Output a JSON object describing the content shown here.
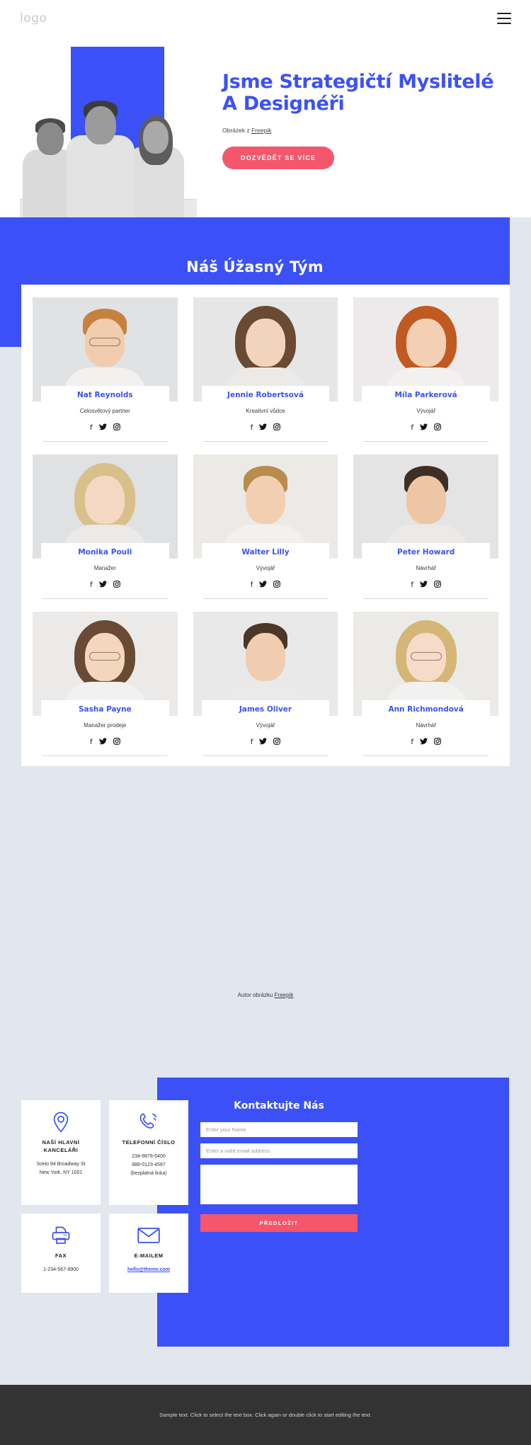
{
  "header": {
    "logo": "logo",
    "menu_icon": "hamburger-menu-icon"
  },
  "hero": {
    "title": "Jsme Strategičtí Myslitelé A Designéři",
    "credit_prefix": "Obrázek z ",
    "credit_link": "Freepik",
    "cta_label": "DOZVĚDĚT SE VÍCE",
    "accent_blue": "#3b51f7",
    "accent_pink": "#f4566c"
  },
  "team": {
    "heading": "Náš Úžasný Tým",
    "credit_prefix": "Autor obrázku ",
    "credit_link": "Freepik",
    "social": [
      "f",
      "🐦",
      "▣"
    ],
    "members": [
      {
        "name": "Nat Reynolds",
        "role": "Celosvětový partner"
      },
      {
        "name": "Jennie Robertsová",
        "role": "Kreativní vůdce"
      },
      {
        "name": "Míla Parkerová",
        "role": "Vývojář"
      },
      {
        "name": "Monika Pouli",
        "role": "Manažer"
      },
      {
        "name": "Walter Lilly",
        "role": "Vývojář"
      },
      {
        "name": "Peter Howard",
        "role": "Návrhář"
      },
      {
        "name": "Sasha Payne",
        "role": "Manažer prodeje"
      },
      {
        "name": "James Oliver",
        "role": "Vývojář"
      },
      {
        "name": "Ann Richmondová",
        "role": "Návrhář"
      }
    ]
  },
  "contact": {
    "cards": [
      {
        "icon": "location-pin-icon",
        "title": "NAŠÍ HLAVNÍ KANCELÁŘI",
        "lines": [
          "SoHo 94 Broadway St",
          "New York, NY 1001"
        ]
      },
      {
        "icon": "phone-icon",
        "title": "TELEFONNÍ ČÍSLO",
        "lines": [
          "234-9876-5400",
          "888-0123-4567",
          "(bezplatná linka)"
        ]
      },
      {
        "icon": "printer-icon",
        "title": "FAX",
        "lines": [
          "1-234-567-8900"
        ]
      },
      {
        "icon": "envelope-icon",
        "title": "E-MAILEM",
        "lines": [
          "hello@theme.com"
        ]
      }
    ],
    "form": {
      "title": "Kontaktujte Nás",
      "name_placeholder": "Enter your Name",
      "email_placeholder": "Enter a valid email address",
      "message_placeholder": "",
      "submit_label": "PŘEDLOŽIT"
    }
  },
  "footer": {
    "text": "Sample text. Click to select the text box. Click again or double click to start editing the text."
  }
}
